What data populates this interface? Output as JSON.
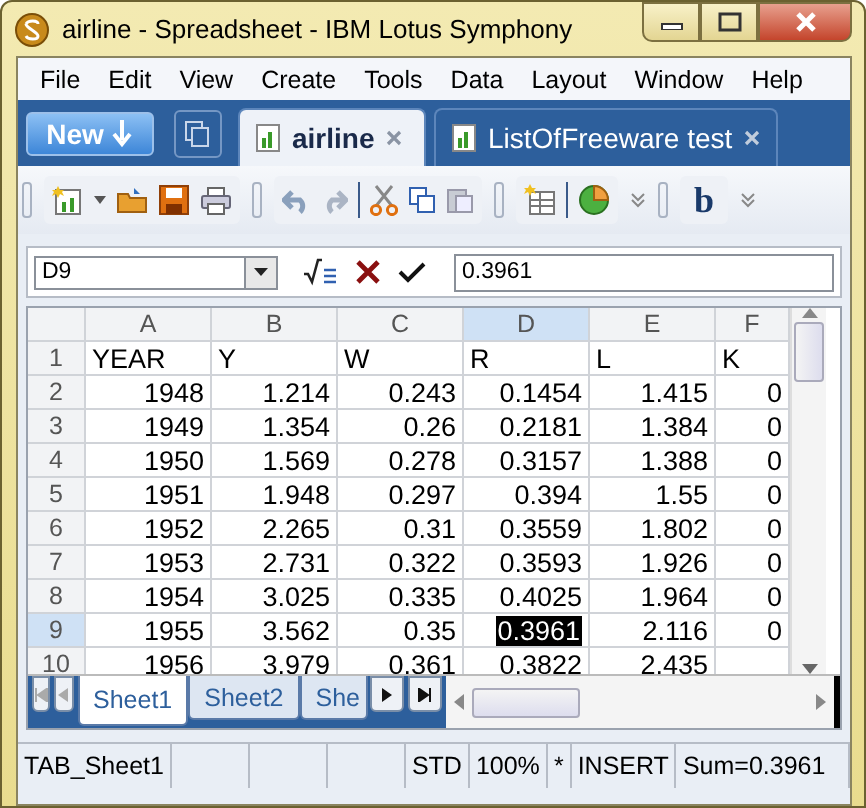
{
  "window": {
    "title": "airline - Spreadsheet - IBM Lotus Symphony"
  },
  "menu": [
    "File",
    "Edit",
    "View",
    "Create",
    "Tools",
    "Data",
    "Layout",
    "Window",
    "Help"
  ],
  "new_button": {
    "label": "New"
  },
  "doc_tabs": [
    {
      "label": "airline",
      "selected": true
    },
    {
      "label": "ListOfFreeware test",
      "selected": false
    }
  ],
  "toolbar": {
    "bold_label": "b"
  },
  "formula_bar": {
    "cell_reference": "D9",
    "value": "0.3961"
  },
  "grid": {
    "columns": [
      {
        "label": "A",
        "selected": false
      },
      {
        "label": "B",
        "selected": false
      },
      {
        "label": "C",
        "selected": false
      },
      {
        "label": "D",
        "selected": true
      },
      {
        "label": "E",
        "selected": false
      },
      {
        "label": "F",
        "selected": false
      }
    ],
    "rows": [
      {
        "number": "1",
        "kind": "label",
        "selected": false,
        "cells": [
          {
            "text": "YEAR",
            "selected": false
          },
          {
            "text": "Y",
            "selected": false
          },
          {
            "text": "W",
            "selected": false
          },
          {
            "text": "R",
            "selected": false
          },
          {
            "text": "L",
            "selected": false
          },
          {
            "text": "K",
            "selected": false
          }
        ]
      },
      {
        "number": "2",
        "kind": "number",
        "selected": false,
        "cells": [
          {
            "text": "1948",
            "selected": false
          },
          {
            "text": "1.214",
            "selected": false
          },
          {
            "text": "0.243",
            "selected": false
          },
          {
            "text": "0.1454",
            "selected": false
          },
          {
            "text": "1.415",
            "selected": false
          },
          {
            "text": "0",
            "selected": false
          }
        ]
      },
      {
        "number": "3",
        "kind": "number",
        "selected": false,
        "cells": [
          {
            "text": "1949",
            "selected": false
          },
          {
            "text": "1.354",
            "selected": false
          },
          {
            "text": "0.26",
            "selected": false
          },
          {
            "text": "0.2181",
            "selected": false
          },
          {
            "text": "1.384",
            "selected": false
          },
          {
            "text": "0",
            "selected": false
          }
        ]
      },
      {
        "number": "4",
        "kind": "number",
        "selected": false,
        "cells": [
          {
            "text": "1950",
            "selected": false
          },
          {
            "text": "1.569",
            "selected": false
          },
          {
            "text": "0.278",
            "selected": false
          },
          {
            "text": "0.3157",
            "selected": false
          },
          {
            "text": "1.388",
            "selected": false
          },
          {
            "text": "0",
            "selected": false
          }
        ]
      },
      {
        "number": "5",
        "kind": "number",
        "selected": false,
        "cells": [
          {
            "text": "1951",
            "selected": false
          },
          {
            "text": "1.948",
            "selected": false
          },
          {
            "text": "0.297",
            "selected": false
          },
          {
            "text": "0.394",
            "selected": false
          },
          {
            "text": "1.55",
            "selected": false
          },
          {
            "text": "0",
            "selected": false
          }
        ]
      },
      {
        "number": "6",
        "kind": "number",
        "selected": false,
        "cells": [
          {
            "text": "1952",
            "selected": false
          },
          {
            "text": "2.265",
            "selected": false
          },
          {
            "text": "0.31",
            "selected": false
          },
          {
            "text": "0.3559",
            "selected": false
          },
          {
            "text": "1.802",
            "selected": false
          },
          {
            "text": "0",
            "selected": false
          }
        ]
      },
      {
        "number": "7",
        "kind": "number",
        "selected": false,
        "cells": [
          {
            "text": "1953",
            "selected": false
          },
          {
            "text": "2.731",
            "selected": false
          },
          {
            "text": "0.322",
            "selected": false
          },
          {
            "text": "0.3593",
            "selected": false
          },
          {
            "text": "1.926",
            "selected": false
          },
          {
            "text": "0",
            "selected": false
          }
        ]
      },
      {
        "number": "8",
        "kind": "number",
        "selected": false,
        "cells": [
          {
            "text": "1954",
            "selected": false
          },
          {
            "text": "3.025",
            "selected": false
          },
          {
            "text": "0.335",
            "selected": false
          },
          {
            "text": "0.4025",
            "selected": false
          },
          {
            "text": "1.964",
            "selected": false
          },
          {
            "text": "0",
            "selected": false
          }
        ]
      },
      {
        "number": "9",
        "kind": "number",
        "selected": true,
        "cells": [
          {
            "text": "1955",
            "selected": false
          },
          {
            "text": "3.562",
            "selected": false
          },
          {
            "text": "0.35",
            "selected": false
          },
          {
            "text": "0.3961",
            "selected": true
          },
          {
            "text": "2.116",
            "selected": false
          },
          {
            "text": "0",
            "selected": false
          }
        ]
      },
      {
        "number": "10",
        "kind": "number",
        "selected": false,
        "cells": [
          {
            "text": "1956",
            "selected": false
          },
          {
            "text": "3.979",
            "selected": false
          },
          {
            "text": "0.361",
            "selected": false
          },
          {
            "text": "0.3822",
            "selected": false
          },
          {
            "text": "2.435",
            "selected": false
          }
        ]
      }
    ]
  },
  "sheet_tabs": [
    {
      "label": "Sheet1",
      "selected": true
    },
    {
      "label": "Sheet2",
      "selected": false
    },
    {
      "label": "She",
      "selected": false
    }
  ],
  "status_bar": [
    {
      "text": "TAB_Sheet1",
      "kind": "text"
    },
    {
      "kind": "blank"
    },
    {
      "kind": "blank"
    },
    {
      "kind": "blank"
    },
    {
      "text": "STD",
      "kind": "text"
    },
    {
      "text": "100%",
      "kind": "text"
    },
    {
      "text": "*",
      "kind": "text"
    },
    {
      "text": "INSERT",
      "kind": "text"
    },
    {
      "text": "Sum=0.3961",
      "kind": "fill"
    }
  ]
}
